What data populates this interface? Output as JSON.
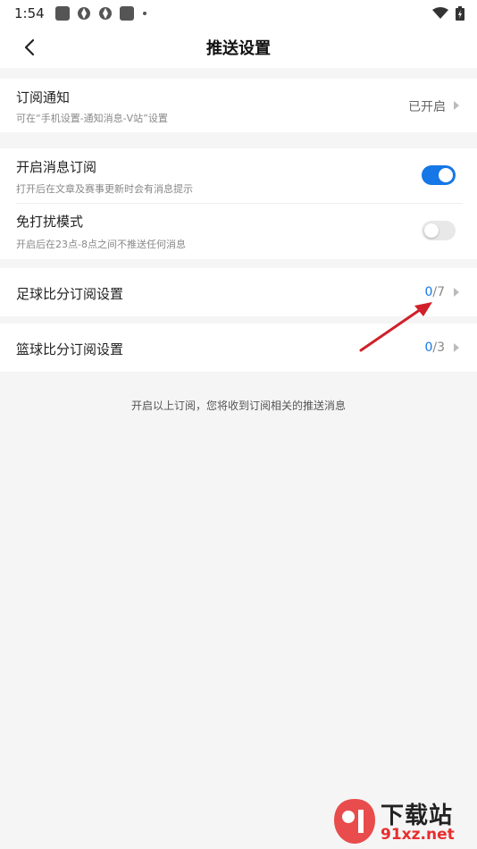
{
  "status_bar": {
    "time": "1:54"
  },
  "header": {
    "title": "推送设置"
  },
  "subscription_notice": {
    "label": "订阅通知",
    "sub": "可在“手机设置-通知消息-V站”设置",
    "value": "已开启"
  },
  "message_subscribe": {
    "label": "开启消息订阅",
    "sub": "打开后在文章及赛事更新时会有消息提示",
    "enabled": true
  },
  "do_not_disturb": {
    "label": "免打扰模式",
    "sub": "开启后在23点-8点之间不推送任何消息",
    "enabled": false
  },
  "football": {
    "label": "足球比分订阅设置",
    "count": "0",
    "total": "/7"
  },
  "basketball": {
    "label": "篮球比分订阅设置",
    "count": "0",
    "total": "/3"
  },
  "footnote": "开启以上订阅，您将收到订阅相关的推送消息",
  "watermark": {
    "top": "下载站",
    "bottom": "91xz.net"
  },
  "colors": {
    "accent": "#1677e6",
    "arrow": "#d0202a",
    "background": "#f5f5f5"
  }
}
